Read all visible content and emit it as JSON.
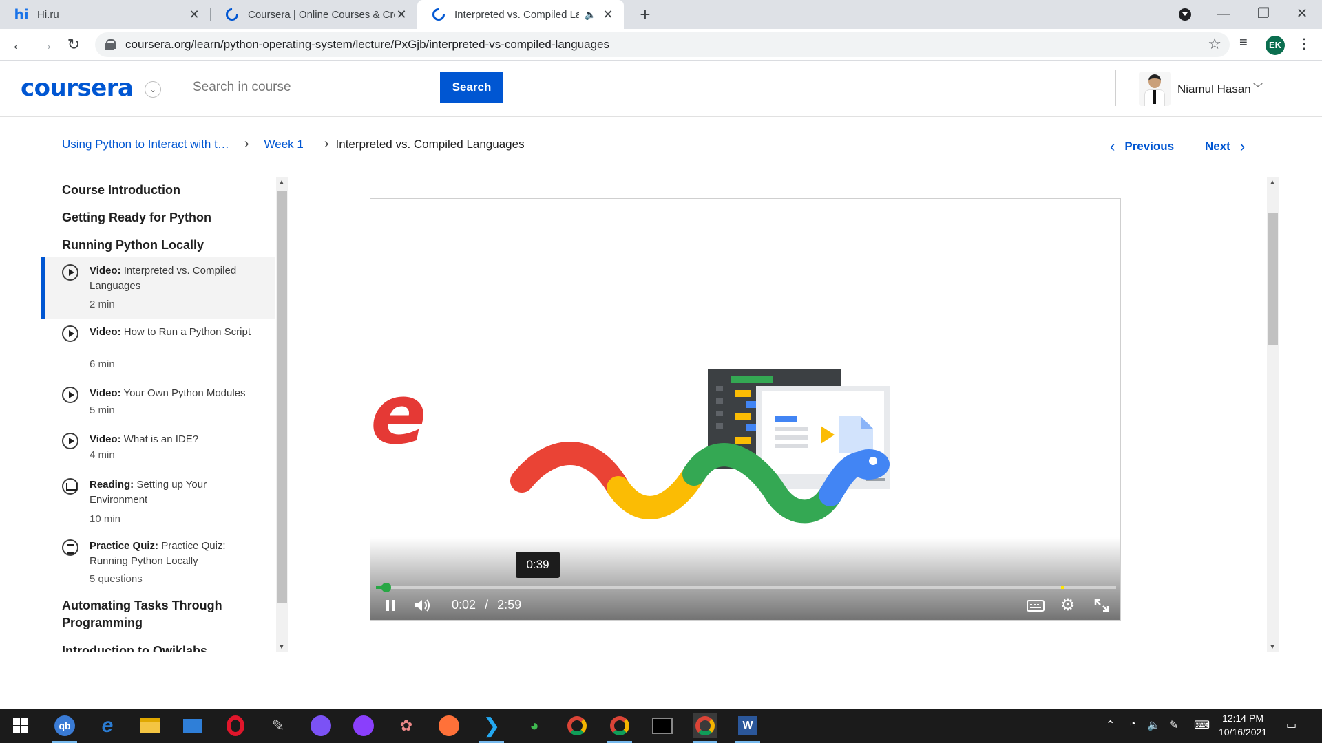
{
  "browser": {
    "tabs": [
      {
        "title": "Hi.ru",
        "favicon": "hi-favicon"
      },
      {
        "title": "Coursera | Online Courses & Cre",
        "favicon": "coursera-favicon"
      },
      {
        "title": "Interpreted vs. Compiled Lan",
        "favicon": "coursera-favicon",
        "active": true,
        "audio": true
      }
    ],
    "url": "coursera.org/learn/python-operating-system/lecture/PxGjb/interpreted-vs-compiled-languages",
    "profile_initials": "EK"
  },
  "header": {
    "logo": "coursera",
    "search_placeholder": "Search in course",
    "search_button": "Search",
    "user_name": "Niamul Hasan"
  },
  "breadcrumb": {
    "course": "Using Python to Interact with t…",
    "week": "Week 1",
    "current": "Interpreted vs. Compiled Languages"
  },
  "nav": {
    "previous": "Previous",
    "next": "Next"
  },
  "sidebar": {
    "sections": [
      "Course Introduction",
      "Getting Ready for Python",
      "Running Python Locally",
      "Automating Tasks Through Programming",
      "Introduction to Qwiklabs"
    ],
    "items": [
      {
        "type": "Video:",
        "title": "Interpreted vs. Compiled Languages",
        "meta": "2 min",
        "icon": "play-icon",
        "active": true
      },
      {
        "type": "Video:",
        "title": "How to Run a Python Script",
        "meta": "6 min",
        "icon": "play-icon"
      },
      {
        "type": "Video:",
        "title": "Your Own Python Modules",
        "meta": "5 min",
        "icon": "play-icon"
      },
      {
        "type": "Video:",
        "title": "What is an IDE?",
        "meta": "4 min",
        "icon": "play-icon"
      },
      {
        "type": "Reading:",
        "title": "Setting up Your Environment",
        "meta": "10 min",
        "icon": "book-icon"
      },
      {
        "type": "Practice Quiz:",
        "title": "Practice Quiz: Running Python Locally",
        "meta": "5 questions",
        "icon": "quiz-icon"
      }
    ]
  },
  "video": {
    "hover_time": "0:39",
    "current_time": "0:02",
    "separator": "/",
    "duration": "2:59",
    "progress_fraction": 0.011,
    "logo_letter": "e"
  },
  "taskbar": {
    "time": "12:14 PM",
    "date": "10/16/2021"
  },
  "colors": {
    "brand": "#0056d2",
    "progress": "#28a745",
    "taskbar": "#1b1b1b"
  }
}
